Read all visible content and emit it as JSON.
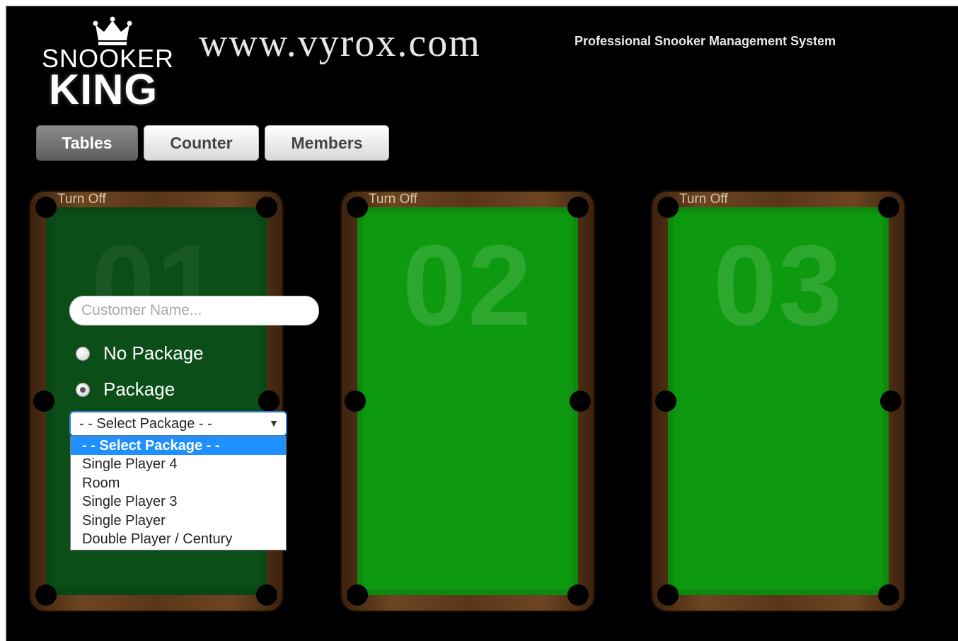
{
  "header": {
    "logo_top": "SNOOKER",
    "logo_bottom": "KING",
    "site_url": "www.vyrox.com",
    "tagline": "Professional Snooker Management System"
  },
  "nav": {
    "tabs": [
      {
        "label": "Tables",
        "active": true
      },
      {
        "label": "Counter",
        "active": false
      },
      {
        "label": "Members",
        "active": false
      }
    ]
  },
  "tables": [
    {
      "number": "01",
      "turn_off_label": "Turn Off"
    },
    {
      "number": "02",
      "turn_off_label": "Turn Off"
    },
    {
      "number": "03",
      "turn_off_label": "Turn Off"
    }
  ],
  "booking_form": {
    "customer_name_placeholder": "Customer Name...",
    "customer_name_value": "",
    "radio_no_package": "No Package",
    "radio_package": "Package",
    "selected_radio": "Package",
    "select_value": "- - Select Package - -",
    "options": [
      "- - Select Package - -",
      "Single Player 4",
      "Room",
      "Single Player 3",
      "Single Player",
      "Double Player / Century"
    ]
  },
  "colors": {
    "background": "#000000",
    "felt": "#0e9a10",
    "felt_dim": "#0b4e18",
    "wood": "#5a3618",
    "select_highlight": "#1e90ff"
  }
}
